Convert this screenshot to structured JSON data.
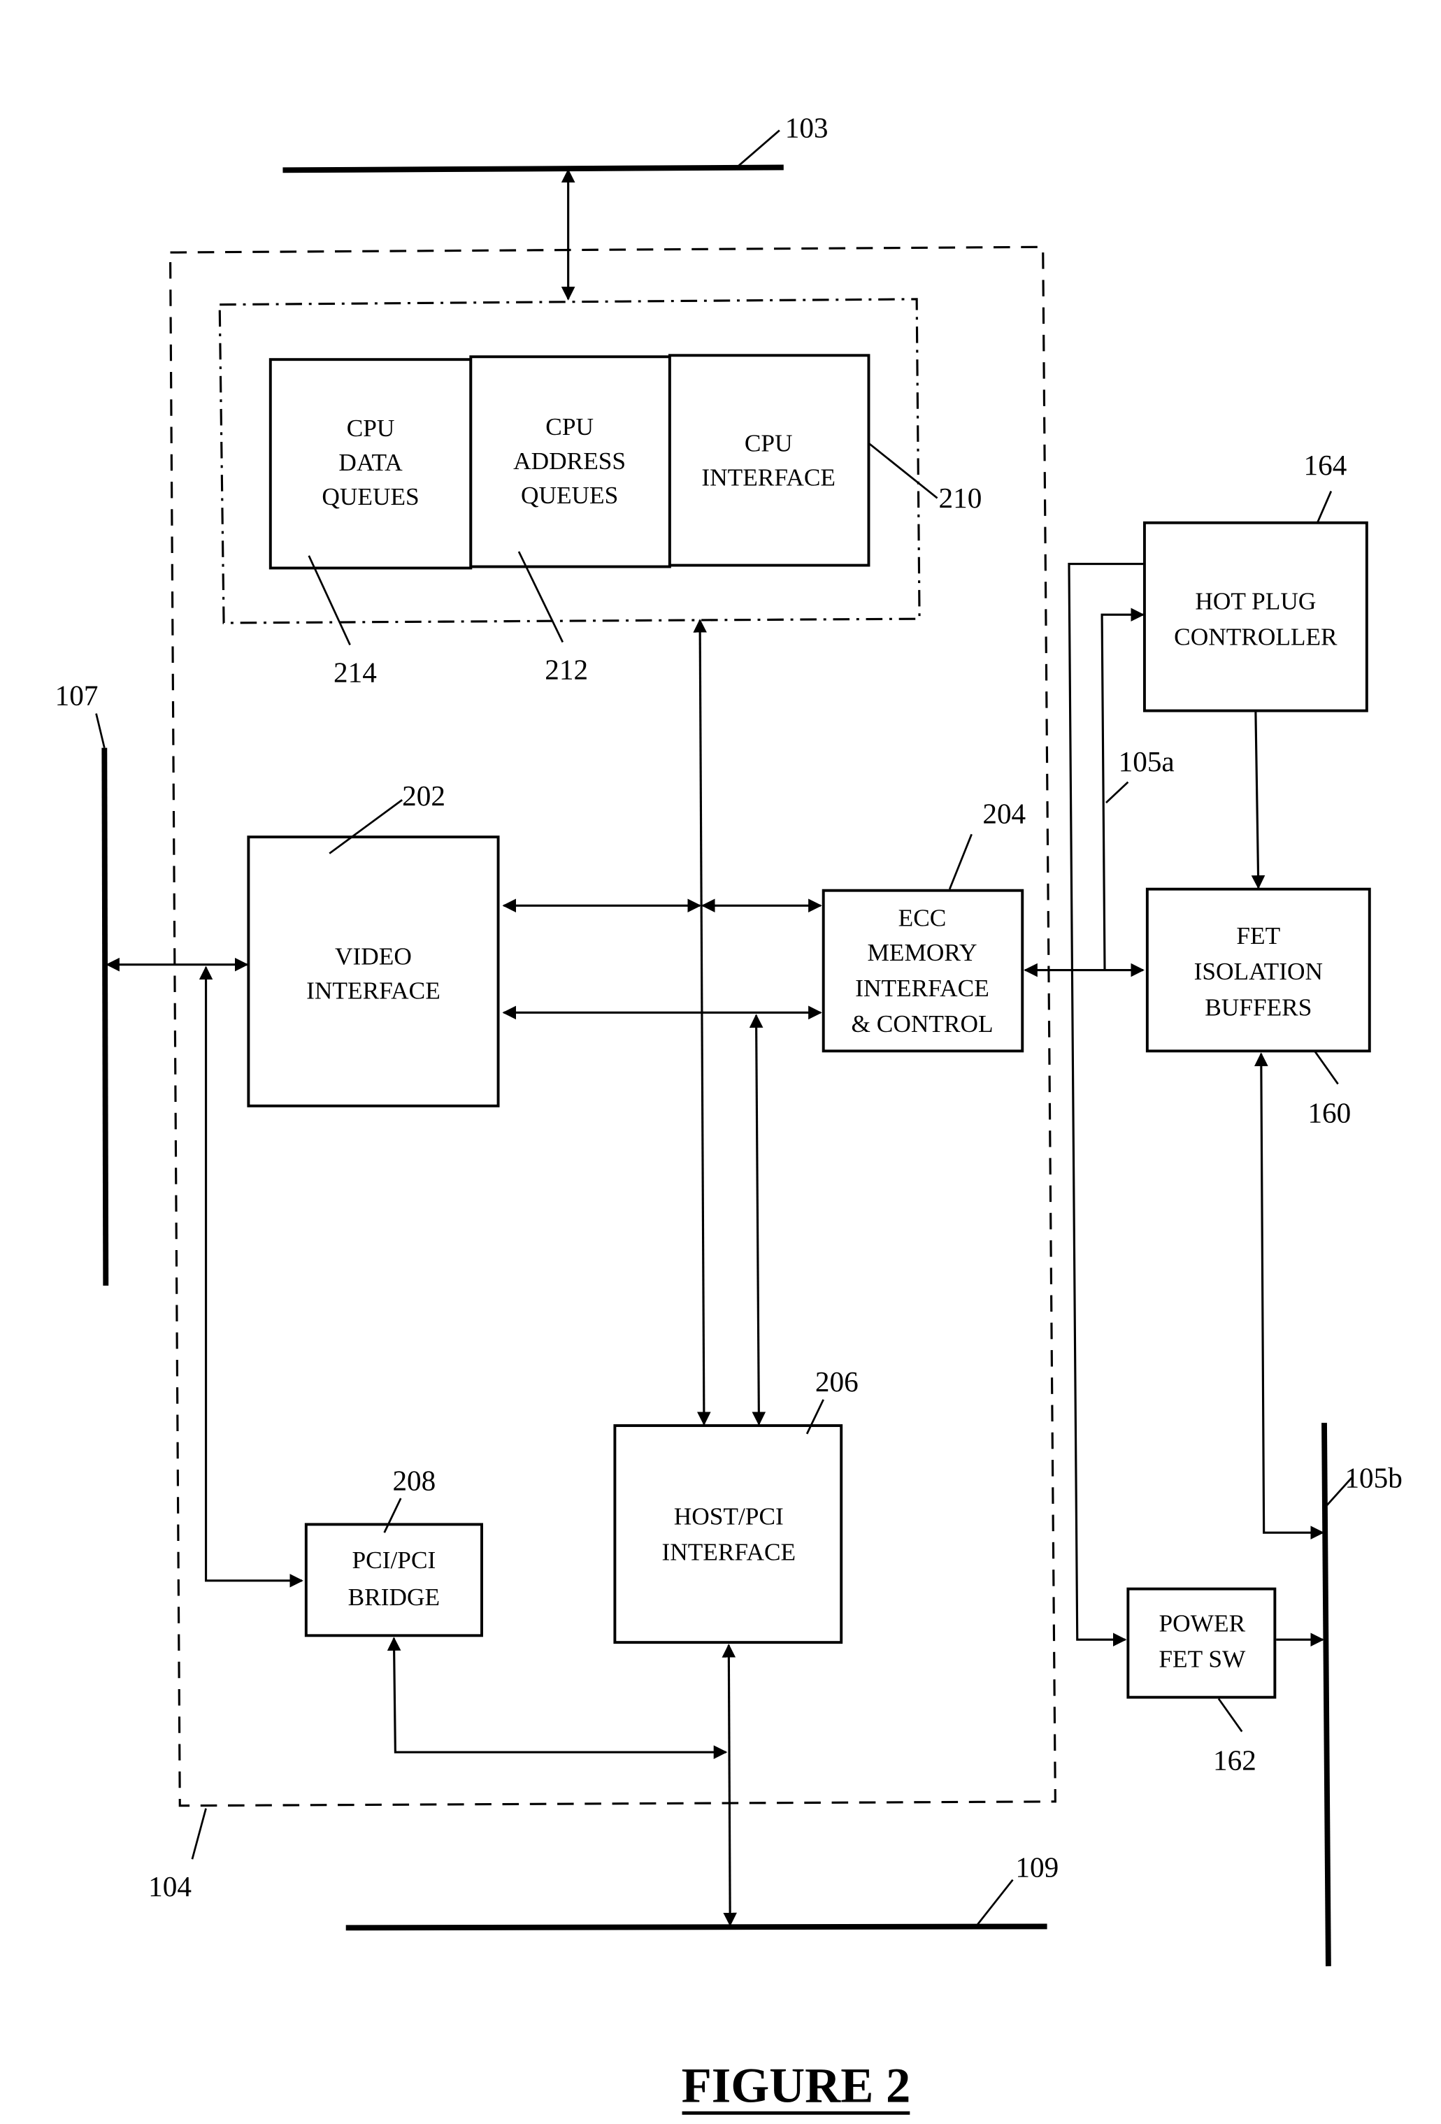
{
  "figure_title": "FIGURE 2",
  "buses": {
    "cpu_bus": "103",
    "video_bus": "107",
    "pci_bus": "109",
    "hot_plug_bus_a": "105a",
    "hot_plug_bus_b": "105b"
  },
  "regions": {
    "host_bridge": "104",
    "cpu_group": "210"
  },
  "blocks": {
    "cpu_data_queues": {
      "lines": [
        "CPU",
        "DATA",
        "QUEUES"
      ],
      "ref": "214"
    },
    "cpu_address_queues": {
      "lines": [
        "CPU",
        "ADDRESS",
        "QUEUES"
      ],
      "ref": "212"
    },
    "cpu_interface": {
      "lines": [
        "CPU",
        "INTERFACE"
      ]
    },
    "video_interface": {
      "lines": [
        "VIDEO",
        "INTERFACE"
      ],
      "ref": "202"
    },
    "ecc_memory": {
      "lines": [
        "ECC",
        "MEMORY",
        "INTERFACE",
        "& CONTROL"
      ],
      "ref": "204"
    },
    "host_pci_interface": {
      "lines": [
        "HOST/PCI",
        "INTERFACE"
      ],
      "ref": "206"
    },
    "pci_pci_bridge": {
      "lines": [
        "PCI/PCI",
        "BRIDGE"
      ],
      "ref": "208"
    },
    "hot_plug_controller": {
      "lines": [
        "HOT PLUG",
        "CONTROLLER"
      ],
      "ref": "164"
    },
    "fet_isolation_buffers": {
      "lines": [
        "FET",
        "ISOLATION",
        "BUFFERS"
      ],
      "ref": "160"
    },
    "power_fet_sw": {
      "lines": [
        "POWER",
        "FET SW"
      ],
      "ref": "162"
    }
  }
}
